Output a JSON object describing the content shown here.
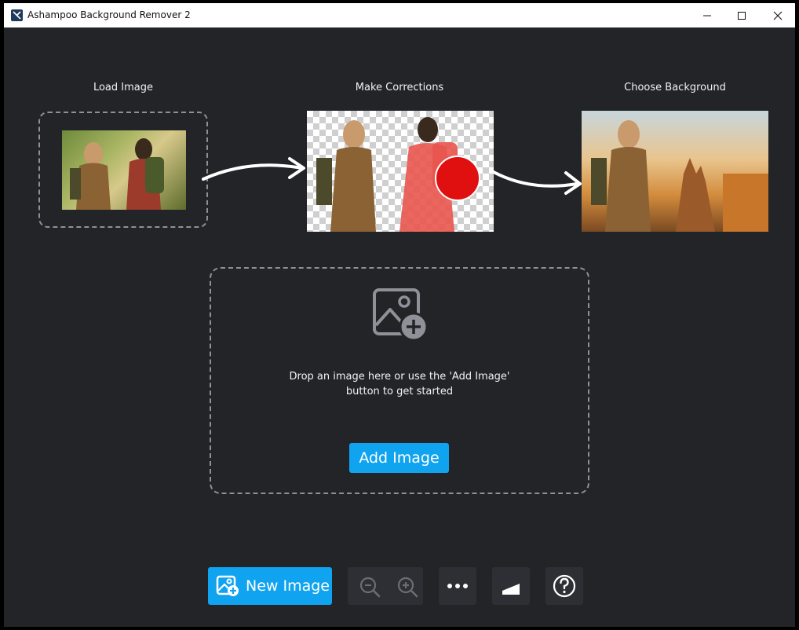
{
  "window": {
    "title": "Ashampoo Background Remover 2",
    "controls": [
      "minimize",
      "maximize",
      "close"
    ]
  },
  "steps": [
    {
      "label": "Load Image"
    },
    {
      "label": "Make Corrections"
    },
    {
      "label": "Choose Background"
    }
  ],
  "drop_zone": {
    "text_line1": "Drop an image here or use the 'Add Image'",
    "text_line2": "button to get started",
    "add_button": "Add Image"
  },
  "toolbar": {
    "new_image": "New Image",
    "icons": [
      "image-plus-icon",
      "zoom-out-icon",
      "zoom-in-icon",
      "more-icon",
      "compare-icon",
      "help-icon"
    ]
  },
  "colors": {
    "accent": "#10a3ef",
    "background": "#222428",
    "button_dark": "#2d2f34",
    "brush": "#e01010"
  }
}
